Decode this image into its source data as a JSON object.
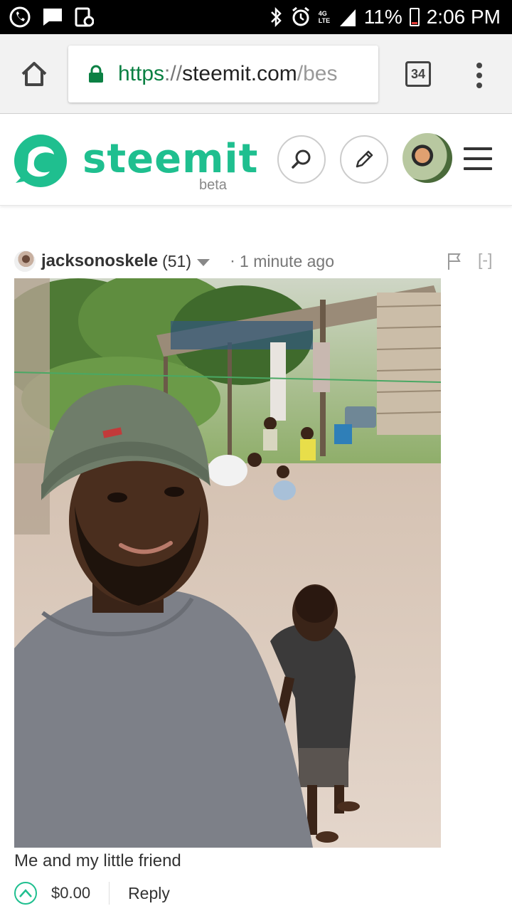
{
  "status_bar": {
    "battery": "11%",
    "time": "2:06 PM",
    "network": "4G LTE",
    "icons": [
      "viber-icon",
      "message-icon",
      "screenshot-icon",
      "bluetooth-icon",
      "alarm-icon",
      "signal-icon",
      "battery-icon"
    ]
  },
  "browser": {
    "url_scheme": "https",
    "url_sep": "://",
    "url_host": "steemit.com",
    "url_path": "/bes",
    "tab_count": "34"
  },
  "header": {
    "logo_text": "steemit",
    "beta_label": "beta",
    "brand_color": "#1fbf8f"
  },
  "comment": {
    "author": "jacksonoskele",
    "reputation": "(51)",
    "separator": "·",
    "time_ago": "1 minute ago",
    "collapse_label": "[-]",
    "caption": "Me and my little friend",
    "payout": "$0.00",
    "reply_label": "Reply"
  }
}
